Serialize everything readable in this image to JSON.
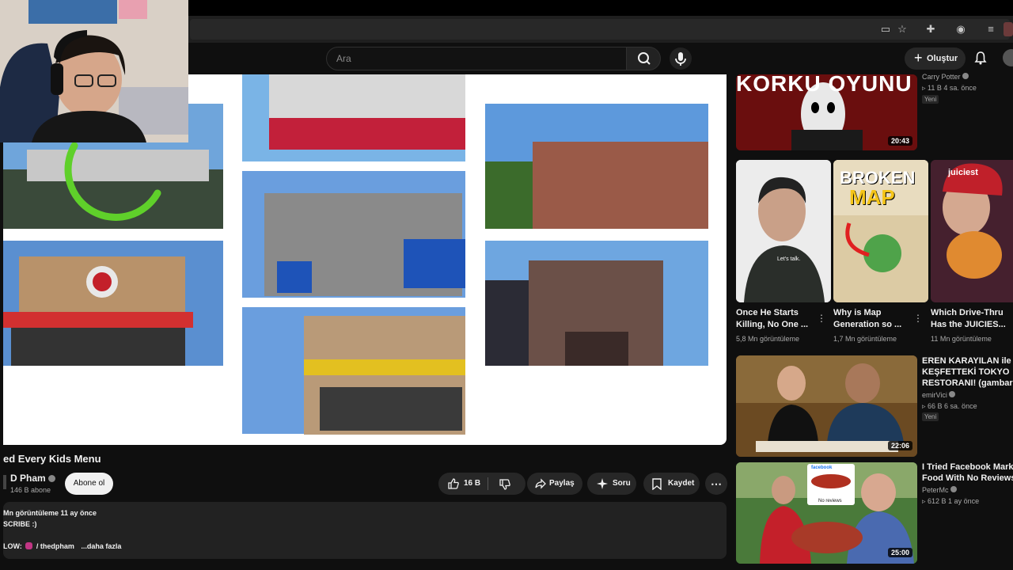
{
  "browser": {
    "toolbar_icons": [
      "cast-icon",
      "star-icon",
      "extensions-icon",
      "profile-icon",
      "reading-list-icon"
    ]
  },
  "header": {
    "search_placeholder": "Ara",
    "create_label": "Oluştur"
  },
  "video": {
    "title": "ed Every Kids Menu",
    "channel": "D Pham",
    "subscribers": "146 B abone",
    "subscribe_label": "Abone ol",
    "likes": "16 B",
    "share_label": "Paylaş",
    "ask_label": "Soru",
    "save_label": "Kaydet",
    "description": {
      "line1": "Mn görüntüleme  11 ay önce",
      "line2": "SCRIBE :)",
      "line3_prefix": "LOW:",
      "line3_handle": "/ thedpham",
      "more": "...daha fazla"
    }
  },
  "recommendations": {
    "top": {
      "thumb_text": "KORKU OYUNU",
      "duration": "20:43",
      "channel": "Carry Potter",
      "meta": "11 B  4 sa. önce",
      "badge": "Yeni"
    },
    "shorts": [
      {
        "title_line1": "Once He Starts",
        "title_line2": "Killing, No One ...",
        "views": "5,8 Mn görüntüleme",
        "overlay": "Let's talk."
      },
      {
        "title_line1": "Why is Map",
        "title_line2": "Generation so ...",
        "views": "1,7 Mn görüntüleme",
        "overlay_line1": "BROKEN",
        "overlay_line2": "MAP"
      },
      {
        "title_line1": "Which Drive-Thru",
        "title_line2": "Has the JUICIES...",
        "views": "11 Mn görüntüleme",
        "overlay": "juiciest"
      }
    ],
    "videos": [
      {
        "title_line1": "EREN KARAYILAN ile",
        "title_line2": "KEŞFETTEKİ TOKYO",
        "title_line3": "RESTORANI! (gambare ...",
        "channel": "emirVici",
        "meta": "66 B  6 sa. önce",
        "badge": "Yeni",
        "duration": "22:06"
      },
      {
        "title_line1": "I Tried Facebook Marketpl",
        "title_line2": "Food With No Reviews",
        "channel": "PeterMc",
        "meta": "612 B  1 ay önce",
        "duration": "25:00",
        "overlay_site": "facebook",
        "overlay_caption": "No reviews"
      }
    ]
  },
  "colors": {
    "background": "#0f0f0f",
    "surface": "#272727",
    "accent_green": "#5fd02a",
    "youtube_red": "#cc1f1f"
  }
}
